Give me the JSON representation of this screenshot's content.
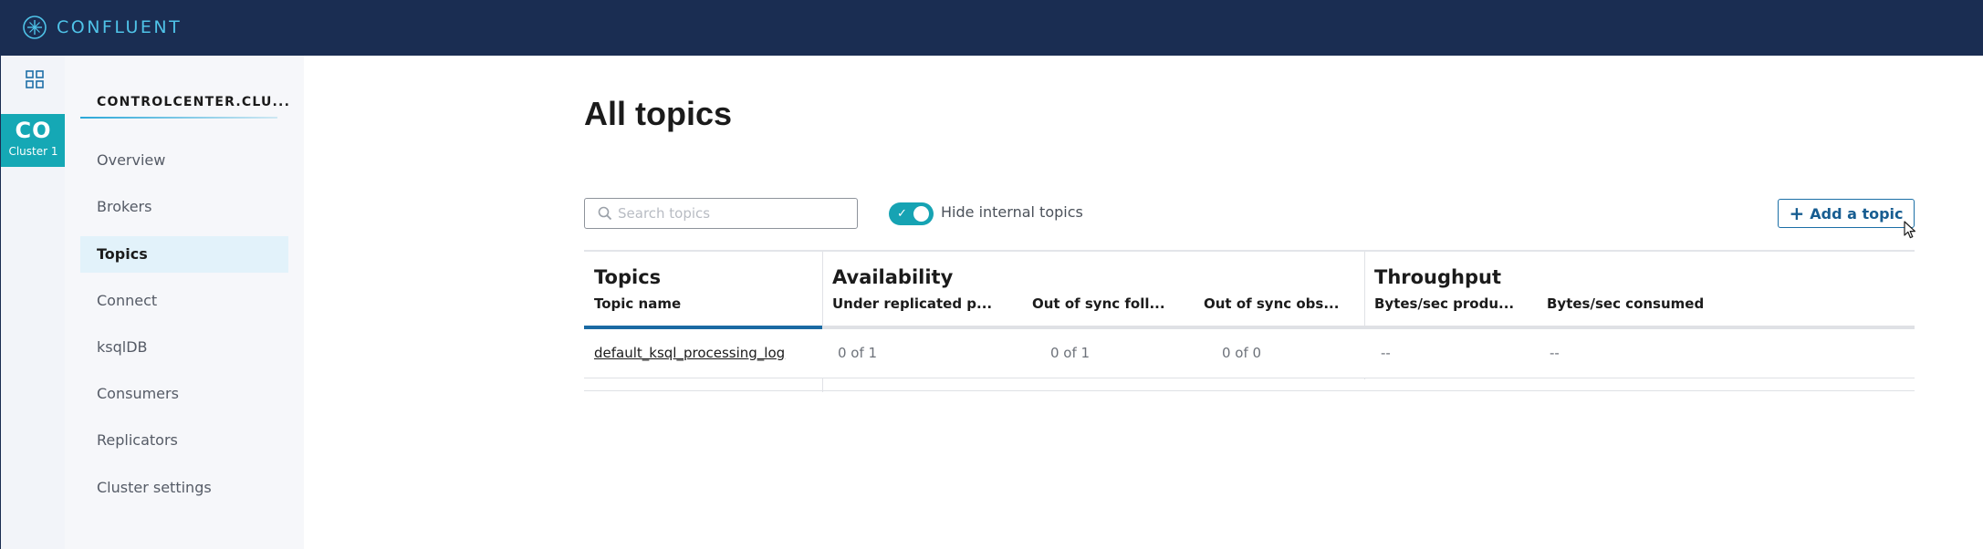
{
  "brand": {
    "name": "CONFLUENT"
  },
  "rail": {
    "cluster_abbr": "CO",
    "cluster_label": "Cluster 1"
  },
  "sidebar": {
    "cluster_name": "CONTROLCENTER.CLU...",
    "items": [
      {
        "label": "Overview",
        "active": false
      },
      {
        "label": "Brokers",
        "active": false
      },
      {
        "label": "Topics",
        "active": true
      },
      {
        "label": "Connect",
        "active": false
      },
      {
        "label": "ksqlDB",
        "active": false
      },
      {
        "label": "Consumers",
        "active": false
      },
      {
        "label": "Replicators",
        "active": false
      },
      {
        "label": "Cluster settings",
        "active": false
      }
    ]
  },
  "main": {
    "title": "All topics",
    "search": {
      "placeholder": "Search topics",
      "value": ""
    },
    "toggle": {
      "label": "Hide internal topics",
      "on": true
    },
    "add_button": {
      "label": "Add a topic"
    }
  },
  "table": {
    "groups": [
      {
        "label": "Topics"
      },
      {
        "label": "Availability"
      },
      {
        "label": "Throughput"
      }
    ],
    "columns": [
      "Topic name",
      "Under replicated p...",
      "Out of sync foll...",
      "Out of sync obs...",
      "Bytes/sec produ...",
      "Bytes/sec consumed"
    ],
    "rows": [
      {
        "topic_name": "default_ksql_processing_log",
        "under_replicated": "0 of 1",
        "out_of_sync_followers": "0 of 1",
        "out_of_sync_observers": "0 of 0",
        "bytes_produced": "--",
        "bytes_consumed": "--"
      }
    ]
  },
  "colors": {
    "header_bg": "#1a2d52",
    "brand_accent": "#4fc3e8",
    "cluster_tile": "#15a8b5",
    "toggle_on": "#16a3b3",
    "primary_button": "#175d91",
    "active_tab_bar": "#1a6aa3"
  },
  "icons": {
    "logo": "confluent-logo-icon",
    "rail_grid": "grid-icon",
    "search": "search-icon",
    "toggle_check": "check-icon",
    "add": "plus-icon",
    "cursor": "mouse-pointer-icon"
  }
}
